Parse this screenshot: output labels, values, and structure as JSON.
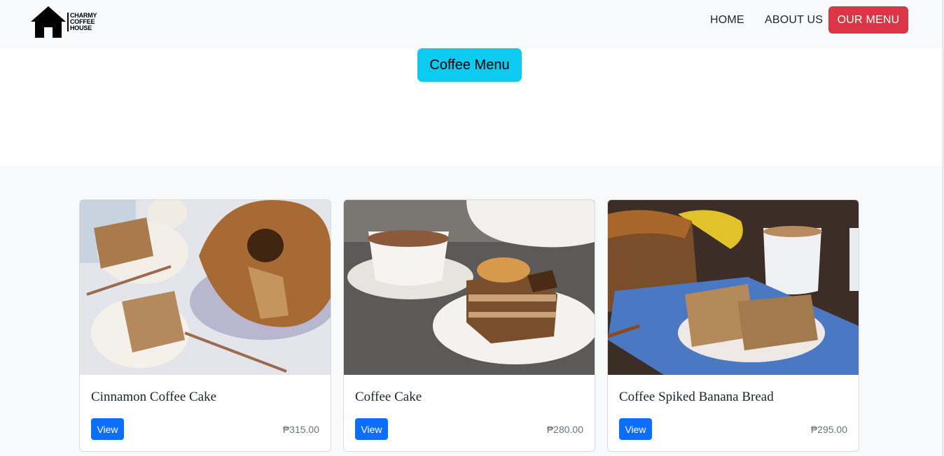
{
  "brand": {
    "line1": "CHARMY",
    "line2": "COFFEE",
    "line3": "HOUSE",
    "icon": "house-icon"
  },
  "nav": {
    "home": "HOME",
    "about": "ABOUT US",
    "menu": "OUR MENU"
  },
  "hero": {
    "button_label": "Coffee Menu"
  },
  "colors": {
    "nav_bg": "#f8f9fa",
    "menu_button": "#dc3545",
    "hero_button": "#0dcaf0",
    "view_button": "#0d6efd"
  },
  "products": [
    {
      "name": "Cinnamon Coffee Cake",
      "button": "View",
      "price": "₱315.00"
    },
    {
      "name": "Coffee Cake",
      "button": "View",
      "price": "₱280.00"
    },
    {
      "name": "Coffee Spiked Banana Bread",
      "button": "View",
      "price": "₱295.00"
    }
  ]
}
